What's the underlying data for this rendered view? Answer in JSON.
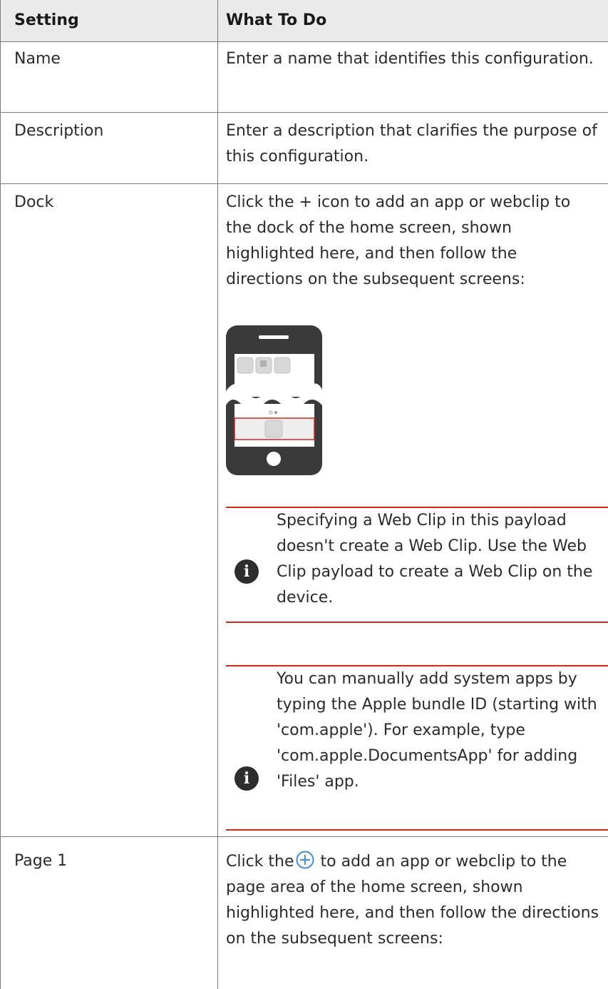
{
  "table": {
    "header": {
      "setting": "Setting",
      "what_to_do": "What To Do"
    },
    "rows": [
      {
        "setting": "Name",
        "what_to_do": "Enter a name that identifies this configuration."
      },
      {
        "setting": "Description",
        "what_to_do": "Enter a description that clarifies the purpose of this configuration."
      },
      {
        "setting": "Dock",
        "what_to_do": "Click the + icon to add an app or webclip to the dock of the home screen, shown highlighted here, and then follow the directions on the subsequent screens:",
        "notes": [
          "Specifying a Web Clip in this payload doesn't create a Web Clip. Use the Web Clip payload to create a Web Clip on the device.",
          "You can manually add system apps by typing the Apple bundle ID (starting with 'com.apple'). For example, type 'com.apple.DocumentsApp' for adding 'Files' app."
        ]
      },
      {
        "setting": "Page 1",
        "what_to_do_before_icon": "Click the",
        "what_to_do_after_icon": "to add an app or webclip to the page area of the home screen, shown highlighted here, and then follow the directions on the subsequent screens:"
      }
    ]
  },
  "icons": {
    "note": "info-icon",
    "add": "plus-circle-icon",
    "phone": "phone-illustration"
  },
  "colors": {
    "header_bg": "#eaeaea",
    "rule": "#7a7a7a",
    "note_rule": "#d9231c",
    "icon_dark": "#2d2d2d",
    "plus_blue": "#3d8fd6",
    "highlight_red": "#d9231c"
  }
}
